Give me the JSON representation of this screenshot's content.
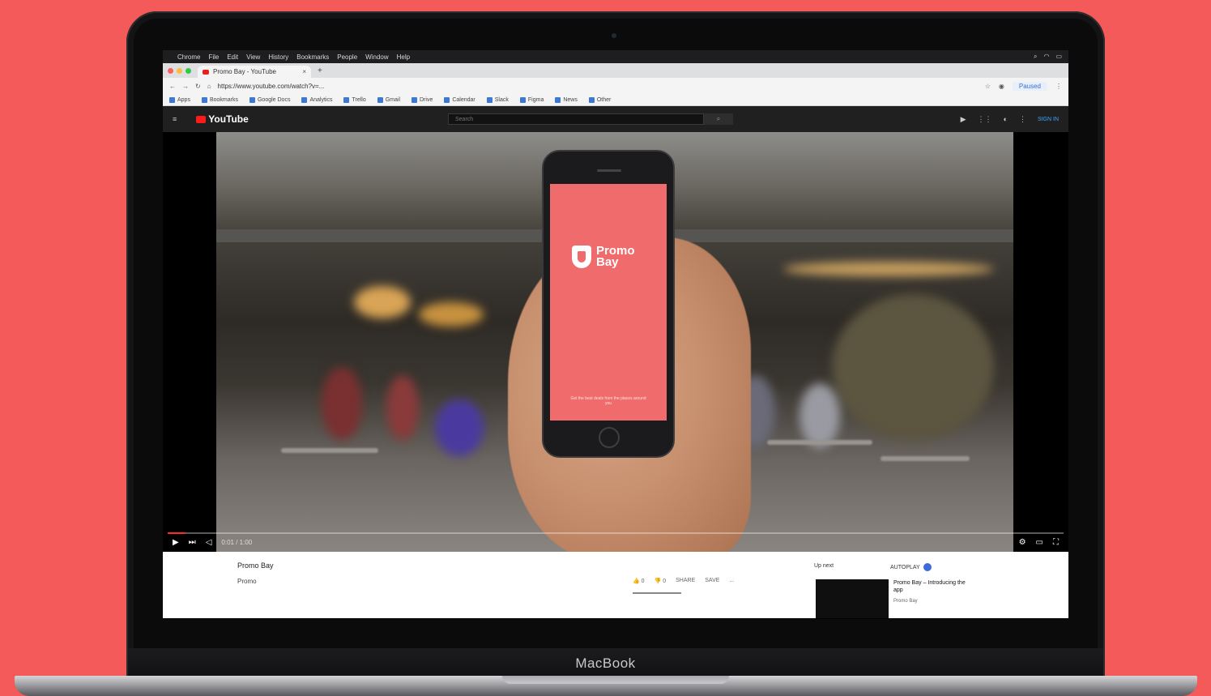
{
  "device": {
    "brand": "MacBook"
  },
  "macos_menubar": {
    "items": [
      "Chrome",
      "File",
      "Edit",
      "View",
      "History",
      "Bookmarks",
      "People",
      "Window",
      "Help"
    ],
    "status_icons": [
      "search-icon",
      "wifi-icon",
      "battery-icon"
    ]
  },
  "browser": {
    "tab_title": "Promo Bay - YouTube",
    "tab_close": "×",
    "new_tab": "+",
    "url": "https://www.youtube.com/watch?v=...",
    "user_chip": "Paused",
    "bookmarks": [
      "Apps",
      "Bookmarks",
      "Google Docs",
      "Analytics",
      "Trello",
      "Gmail",
      "Drive",
      "Calendar",
      "Slack",
      "Figma",
      "News",
      "Other"
    ]
  },
  "youtube": {
    "logo": "YouTube",
    "search_placeholder": "Search",
    "search_button": "⌕",
    "sign_in": "SIGN IN"
  },
  "video": {
    "app_name": "Promo Bay",
    "app_tagline": "Get the best deals from the places around you",
    "time": "0:01 / 1:00",
    "progress_fraction": 0.02
  },
  "details": {
    "channel": "Promo Bay",
    "subtitle": "Promo",
    "actions": [
      "👍 0",
      "👎 0",
      "SHARE",
      "SAVE",
      "..."
    ],
    "up_next": "Up next",
    "autoplay": "AUTOPLAY",
    "next_title": "Promo Bay – Introducing the app",
    "next_channel": "Promo Bay"
  },
  "colors": {
    "background": "#f55a5a",
    "app_screen": "#f06b6b",
    "youtube_red": "#ff1a1a"
  }
}
